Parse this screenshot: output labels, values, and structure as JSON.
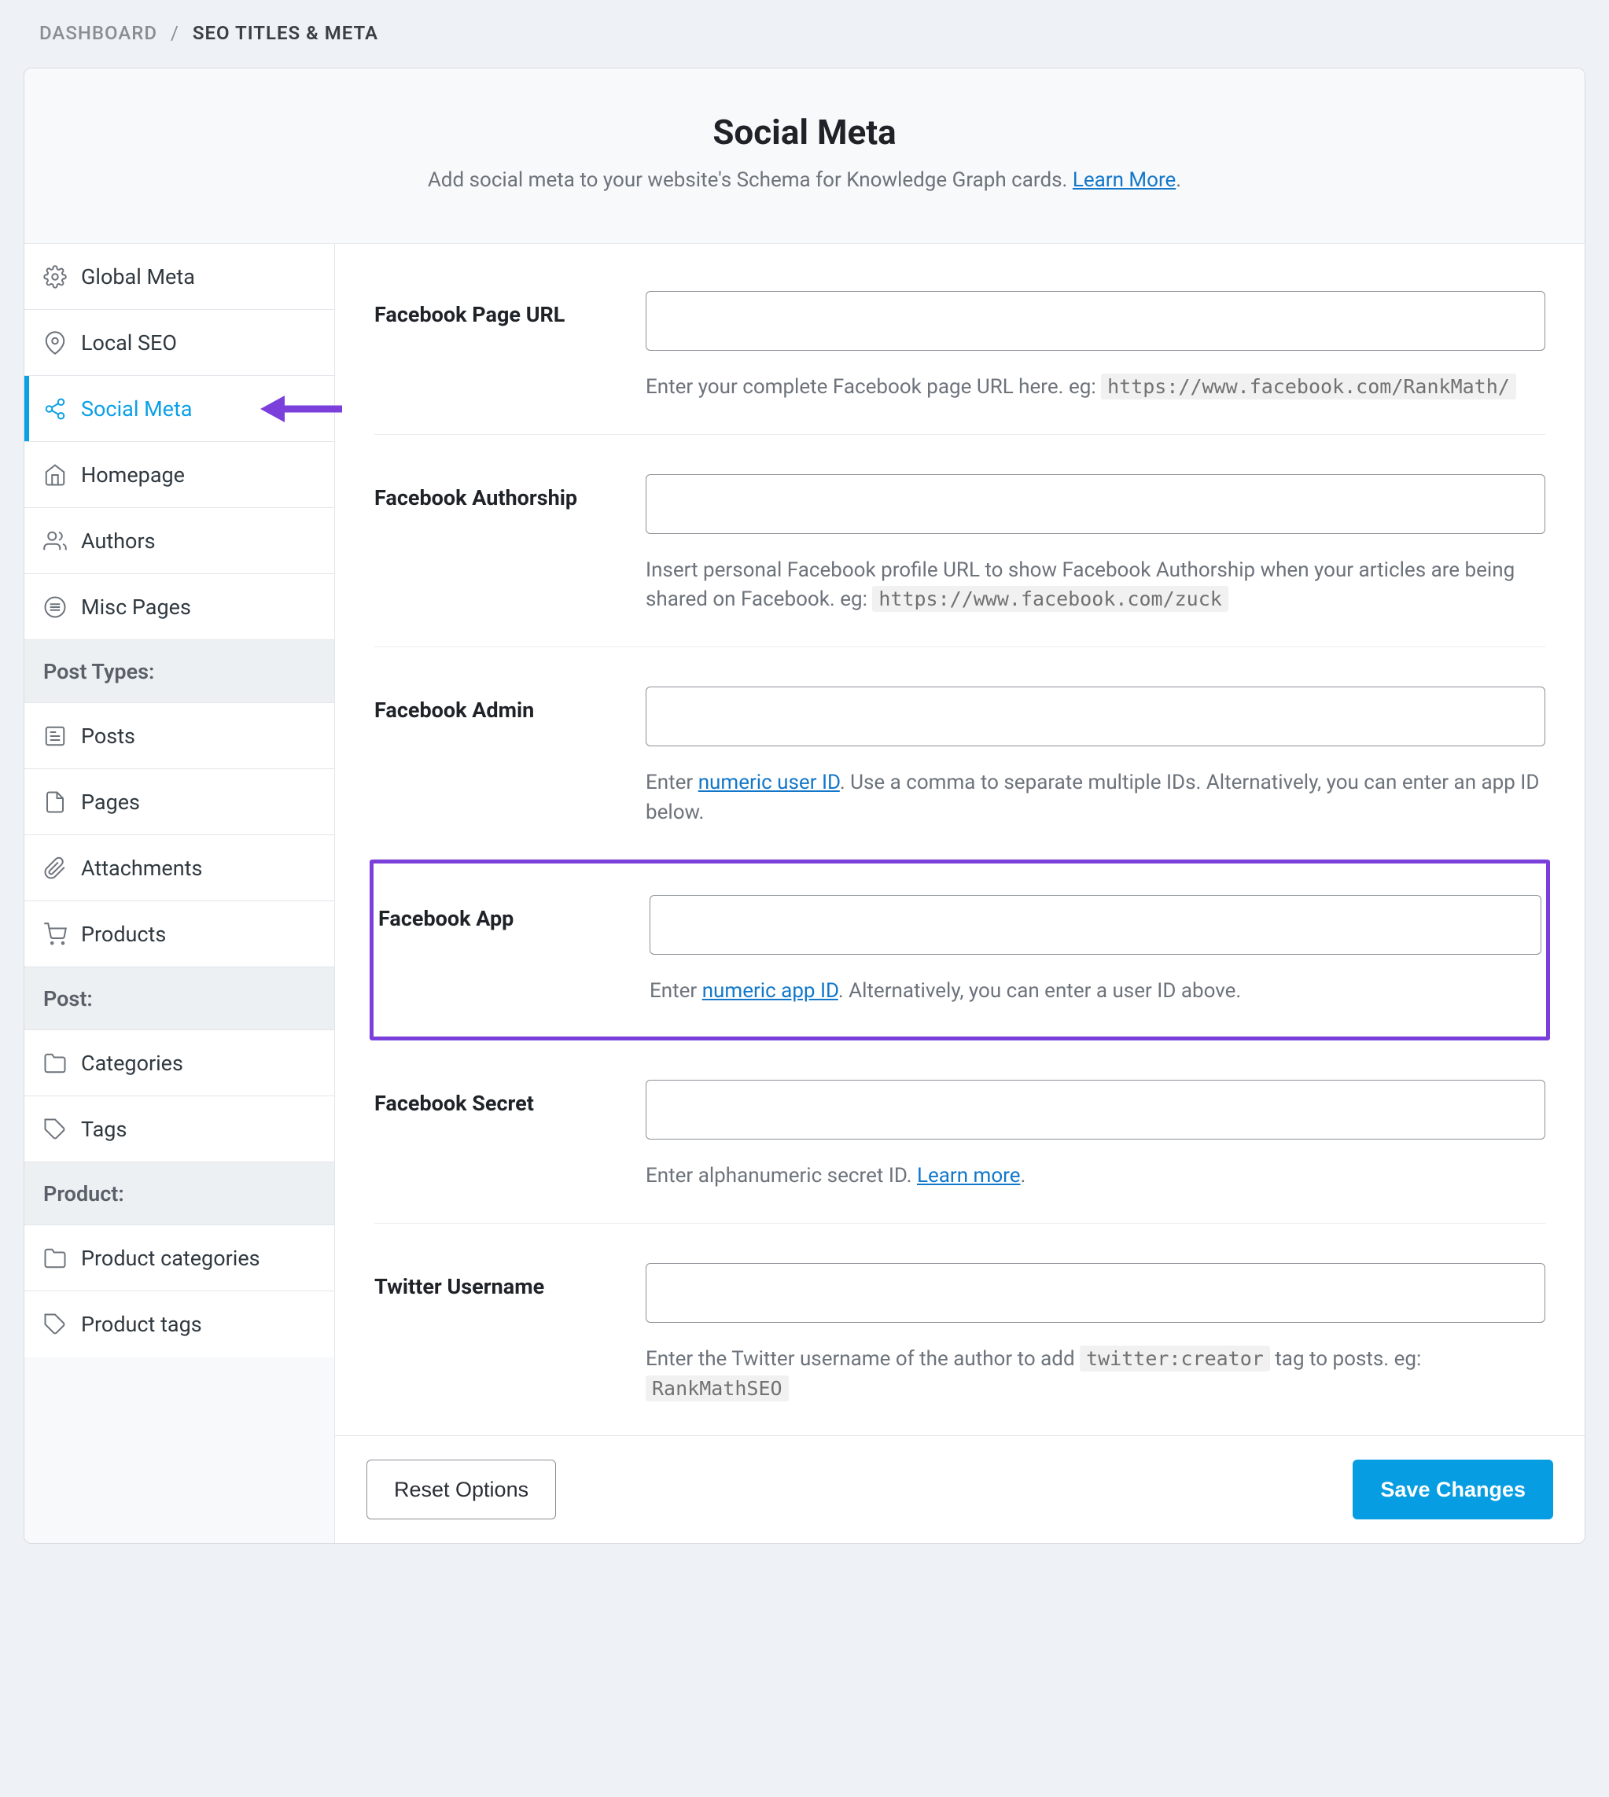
{
  "breadcrumb": {
    "root": "DASHBOARD",
    "current": "SEO TITLES & META"
  },
  "header": {
    "title": "Social Meta",
    "subtitle_pre": "Add social meta to your website's Schema for Knowledge Graph cards. ",
    "learn_more": "Learn More"
  },
  "sidebar": {
    "global_meta": "Global Meta",
    "local_seo": "Local SEO",
    "social_meta": "Social Meta",
    "homepage": "Homepage",
    "authors": "Authors",
    "misc_pages": "Misc Pages",
    "section_post_types": "Post Types:",
    "posts": "Posts",
    "pages": "Pages",
    "attachments": "Attachments",
    "products": "Products",
    "section_post": "Post:",
    "categories": "Categories",
    "tags": "Tags",
    "section_product": "Product:",
    "product_categories": "Product categories",
    "product_tags": "Product tags"
  },
  "fields": {
    "fb_url": {
      "label": "Facebook Page URL",
      "help_pre": "Enter your complete Facebook page URL here. eg: ",
      "help_code": "https://www.facebook.com/RankMath/"
    },
    "fb_author": {
      "label": "Facebook Authorship",
      "help_pre": "Insert personal Facebook profile URL to show Facebook Authorship when your articles are being shared on Facebook. eg: ",
      "help_code": "https://www.facebook.com/zuck"
    },
    "fb_admin": {
      "label": "Facebook Admin",
      "help_pre": "Enter ",
      "help_link": "numeric user ID",
      "help_post": ". Use a comma to separate multiple IDs. Alternatively, you can enter an app ID below."
    },
    "fb_app": {
      "label": "Facebook App",
      "help_pre": "Enter ",
      "help_link": "numeric app ID",
      "help_post": ". Alternatively, you can enter a user ID above."
    },
    "fb_secret": {
      "label": "Facebook Secret",
      "help_pre": "Enter alphanumeric secret ID. ",
      "help_link": "Learn more",
      "help_post": "."
    },
    "tw_user": {
      "label": "Twitter Username",
      "help_pre": "Enter the Twitter username of the author to add ",
      "help_code1": "twitter:creator",
      "help_mid": " tag to posts. eg: ",
      "help_code2": "RankMathSEO"
    }
  },
  "footer": {
    "reset": "Reset Options",
    "save": "Save Changes"
  }
}
